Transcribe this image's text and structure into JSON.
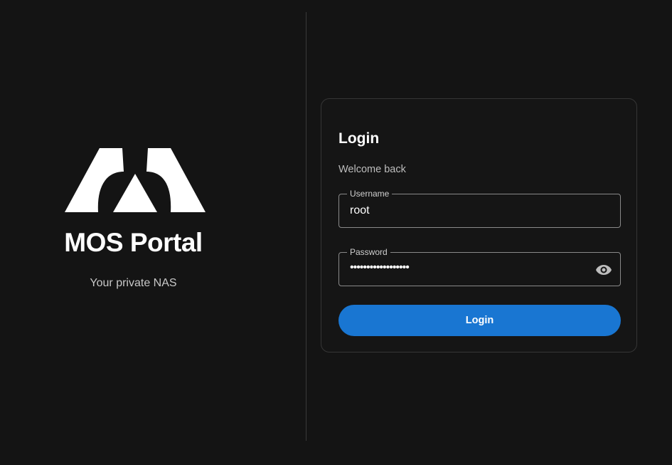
{
  "brand": {
    "title": "MOS Portal",
    "subtitle": "Your private NAS",
    "logo_icon": "mos-logo-icon"
  },
  "login_card": {
    "title": "Login",
    "subtitle": "Welcome back",
    "username": {
      "label": "Username",
      "value": "root"
    },
    "password": {
      "label": "Password",
      "value": "••••••••••••••••••",
      "toggle_icon": "eye-icon"
    },
    "submit_label": "Login"
  },
  "colors": {
    "background": "#141414",
    "accent": "#1976d2",
    "text_primary": "#ffffff",
    "text_secondary": "#bdbdbd"
  }
}
